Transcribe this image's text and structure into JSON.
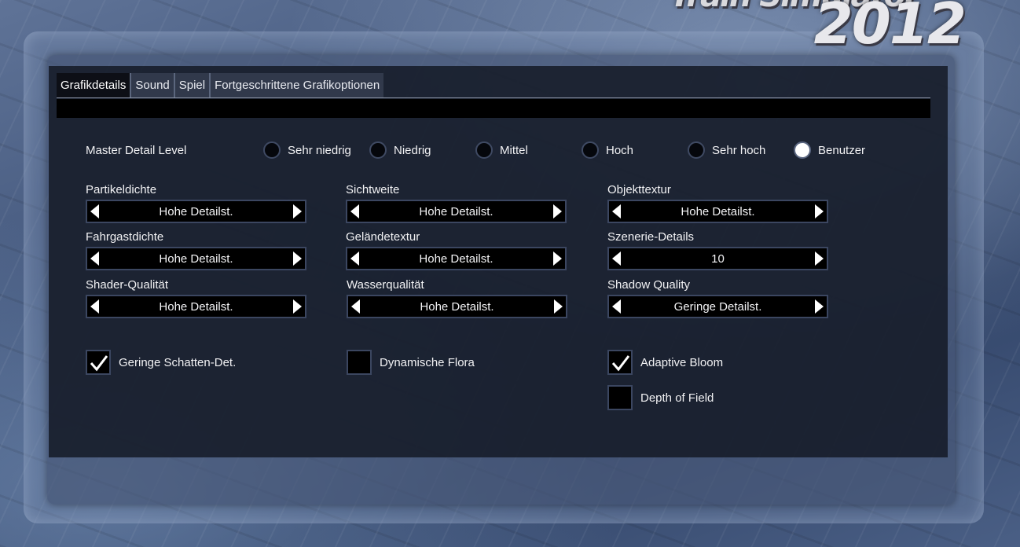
{
  "logo": {
    "line1": "Train Simulator",
    "line2": "2012"
  },
  "tabs": [
    {
      "label": "Grafikdetails",
      "active": true
    },
    {
      "label": "Sound",
      "active": false
    },
    {
      "label": "Spiel",
      "active": false
    },
    {
      "label": "Fortgeschrittene Grafikoptionen",
      "active": false
    }
  ],
  "master": {
    "label": "Master Detail Level",
    "options": [
      {
        "label": "Sehr niedrig",
        "checked": false
      },
      {
        "label": "Niedrig",
        "checked": false
      },
      {
        "label": "Mittel",
        "checked": false
      },
      {
        "label": "Hoch",
        "checked": false
      },
      {
        "label": "Sehr hoch",
        "checked": false
      },
      {
        "label": "Benutzer",
        "checked": true
      }
    ]
  },
  "settings": [
    {
      "label": "Partikeldichte",
      "value": "Hohe Detailst."
    },
    {
      "label": "Sichtweite",
      "value": "Hohe Detailst."
    },
    {
      "label": "Objekttextur",
      "value": "Hohe Detailst."
    },
    {
      "label": "Fahrgastdichte",
      "value": "Hohe Detailst."
    },
    {
      "label": "Geländetextur",
      "value": "Hohe Detailst."
    },
    {
      "label": "Szenerie-Details",
      "value": "10"
    },
    {
      "label": "Shader-Qualität",
      "value": "Hohe Detailst."
    },
    {
      "label": "Wasserqualität",
      "value": "Hohe Detailst."
    },
    {
      "label": "Shadow Quality",
      "value": "Geringe Detailst."
    }
  ],
  "checkboxes": [
    {
      "label": "Geringe Schatten-Det.",
      "checked": true
    },
    {
      "label": "Dynamische Flora",
      "checked": false
    },
    {
      "label": "Adaptive Bloom",
      "checked": true
    },
    {
      "label": "Depth of Field",
      "checked": false
    }
  ],
  "icons": {
    "arrow_left": "arrow-left-icon",
    "arrow_right": "arrow-right-icon",
    "check": "checkmark-icon"
  }
}
